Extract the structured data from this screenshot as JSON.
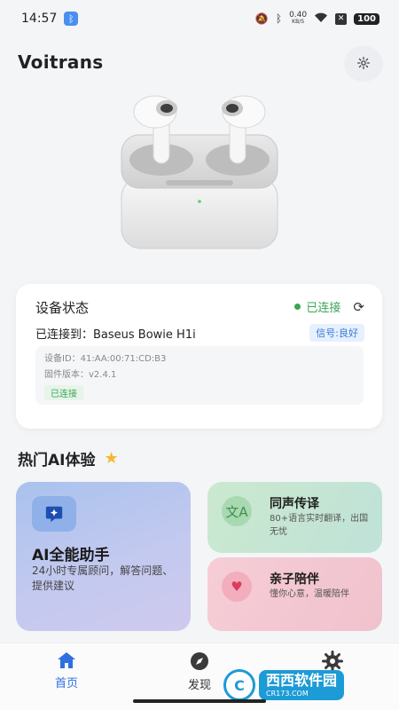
{
  "status_bar": {
    "time": "14:57",
    "net_speed_value": "0.40",
    "net_speed_unit": "KB/S",
    "battery": "100"
  },
  "header": {
    "title": "Voitrans"
  },
  "device_status": {
    "title": "设备状态",
    "connection_state": "已连接",
    "connected_to": "已连接到：Baseus Bowie H1i",
    "signal": "信号:良好",
    "device_id": "设备ID：41:AA:00:71:CD:B3",
    "firmware": "固件版本：v2.4.1",
    "badge": "已连接"
  },
  "section": {
    "title": "热门AI体验"
  },
  "features": {
    "ai": {
      "title": "AI全能助手",
      "desc": "24小时专属顾问，解答问题、提供建议"
    },
    "translate": {
      "title": "同声传译",
      "desc": "80+语言实时翻译，出国无忧"
    },
    "family": {
      "title": "亲子陪伴",
      "desc": "懂你心意，温暖陪伴"
    }
  },
  "nav": {
    "home": "首页",
    "discover": "发现",
    "settings": "设置"
  },
  "watermark": {
    "main": "西西软件园",
    "sub": "CR173.COM"
  },
  "colors": {
    "accent": "#2f6fe0",
    "connected": "#3aa655",
    "star": "#f5b82e"
  }
}
